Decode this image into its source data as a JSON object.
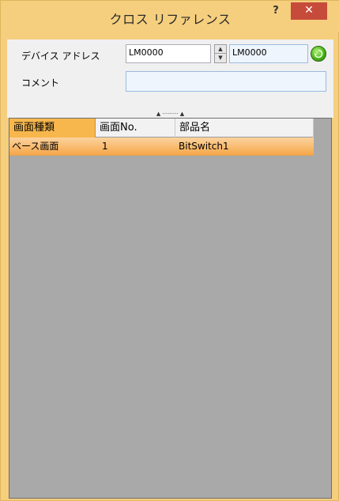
{
  "window": {
    "title": "クロス リファレンス",
    "help_label": "?",
    "close_label": "✕"
  },
  "search": {
    "device_address_label": "デバイス アドレス",
    "address_from": "LM0000",
    "address_to": "LM0000",
    "comment_label": "コメント",
    "comment_value": ""
  },
  "splitter": {
    "glyph": "▲ ········· ▲"
  },
  "table": {
    "columns": [
      "画面種類",
      "画面No.",
      "部品名"
    ],
    "rows": [
      {
        "screen_type": "ベース画面",
        "screen_no": "1",
        "part_name": "BitSwitch1"
      }
    ]
  },
  "colors": {
    "title_bar": "#f5cf7e",
    "close_button": "#c74b3b",
    "selected_row": "#f6a74a",
    "grid_background": "#a9a9a9"
  }
}
